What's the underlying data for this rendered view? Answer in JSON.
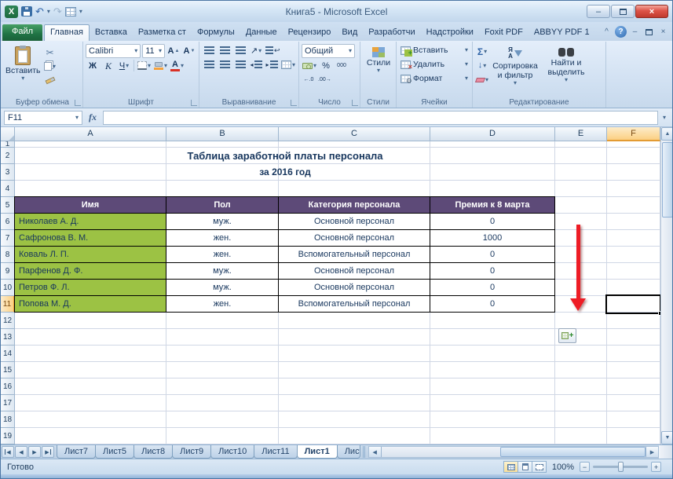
{
  "window": {
    "title": "Книга5  -  Microsoft Excel"
  },
  "colors": {
    "table_header_purple": "#5d4a78",
    "name_cell_green": "#9cc244",
    "arrow_red": "#ee1c25",
    "selected_header_amber": "#fbd083",
    "file_tab_green": "#1f7244",
    "close_button_red": "#dd5347"
  },
  "icons": {
    "excel_x": "X",
    "dropdown": "▾",
    "undo_arrow": "↶",
    "redo_arrow": "↷",
    "minimize": "–",
    "close": "×",
    "collapse": "^",
    "help": "?",
    "scissors": "✂",
    "bold": "Ж",
    "italic": "К",
    "underline": "Ч",
    "font_letter": "А",
    "tri_up": "▲",
    "tri_down": "▼",
    "orientation_arrow": "↗",
    "wrap_arrow": "↩",
    "indent_left": "◂",
    "indent_right": "▸",
    "sigma": "Σ",
    "percent": "%",
    "thousands": "000",
    "inc_decimal": "←.0",
    "dec_decimal": ".00→",
    "fx": "fx",
    "select_all": "◢",
    "arrow_down": "↓",
    "insert_plus": "+",
    "delete_x": "×",
    "gear": "⚙",
    "sort_a": "А",
    "sort_z": "Я",
    "autofill_plus": "+",
    "scroll_up": "▲",
    "scroll_down": "▼",
    "scroll_left": "◀",
    "scroll_right": "▶",
    "nav_left": "◀",
    "nav_right": "▶",
    "zoom_minus": "−",
    "zoom_plus": "+"
  },
  "ribbon": {
    "tabs": [
      "Файл",
      "Главная",
      "Вставка",
      "Разметка ст",
      "Формулы",
      "Данные",
      "Рецензиро",
      "Вид",
      "Разработчи",
      "Надстройки",
      "Foxit PDF",
      "ABBYY PDF 1"
    ],
    "clipboard": {
      "label": "Буфер обмена",
      "paste": "Вставить"
    },
    "font": {
      "label": "Шрифт",
      "name": "Calibri",
      "size": "11"
    },
    "alignment": {
      "label": "Выравнивание"
    },
    "number": {
      "label": "Число",
      "format": "Общий"
    },
    "styles": {
      "label": "Стили"
    },
    "cells": {
      "label": "Ячейки",
      "insert": "Вставить",
      "del": "Удалить",
      "format": "Формат"
    },
    "editing": {
      "label": "Редактирование",
      "sort": "Сортировка и фильтр",
      "find": "Найти и выделить"
    }
  },
  "formula": {
    "name_box": "F11"
  },
  "sheet": {
    "title1": "Таблица заработной платы персонала",
    "title2": "за 2016 год",
    "columns": [
      "A",
      "B",
      "C",
      "D",
      "E",
      "F"
    ],
    "rows": [
      "1",
      "2",
      "3",
      "4",
      "5",
      "6",
      "7",
      "8",
      "9",
      "10",
      "11",
      "12",
      "13",
      "14",
      "15",
      "16",
      "17",
      "18",
      "19"
    ],
    "selected_cell": "F11",
    "table": {
      "headers": [
        "Имя",
        "Пол",
        "Категория персонала",
        "Премия к 8 марта"
      ],
      "rows": [
        [
          "Николаев А. Д.",
          "муж.",
          "Основной персонал",
          "0"
        ],
        [
          "Сафронова В. М.",
          "жен.",
          "Основной персонал",
          "1000"
        ],
        [
          "Коваль Л. П.",
          "жен.",
          "Вспомогательный персонал",
          "0"
        ],
        [
          "Парфенов Д. Ф.",
          "муж.",
          "Основной персонал",
          "0"
        ],
        [
          "Петров Ф. Л.",
          "муж.",
          "Основной персонал",
          "0"
        ],
        [
          "Попова М. Д.",
          "жен.",
          "Вспомогательный персонал",
          "0"
        ]
      ]
    }
  },
  "tabs_bar": {
    "tabs": [
      "Лист7",
      "Лист5",
      "Лист8",
      "Лист9",
      "Лист10",
      "Лист11",
      "Лист1",
      "Лист"
    ]
  },
  "status": {
    "ready": "Готово",
    "zoom": "100%"
  }
}
